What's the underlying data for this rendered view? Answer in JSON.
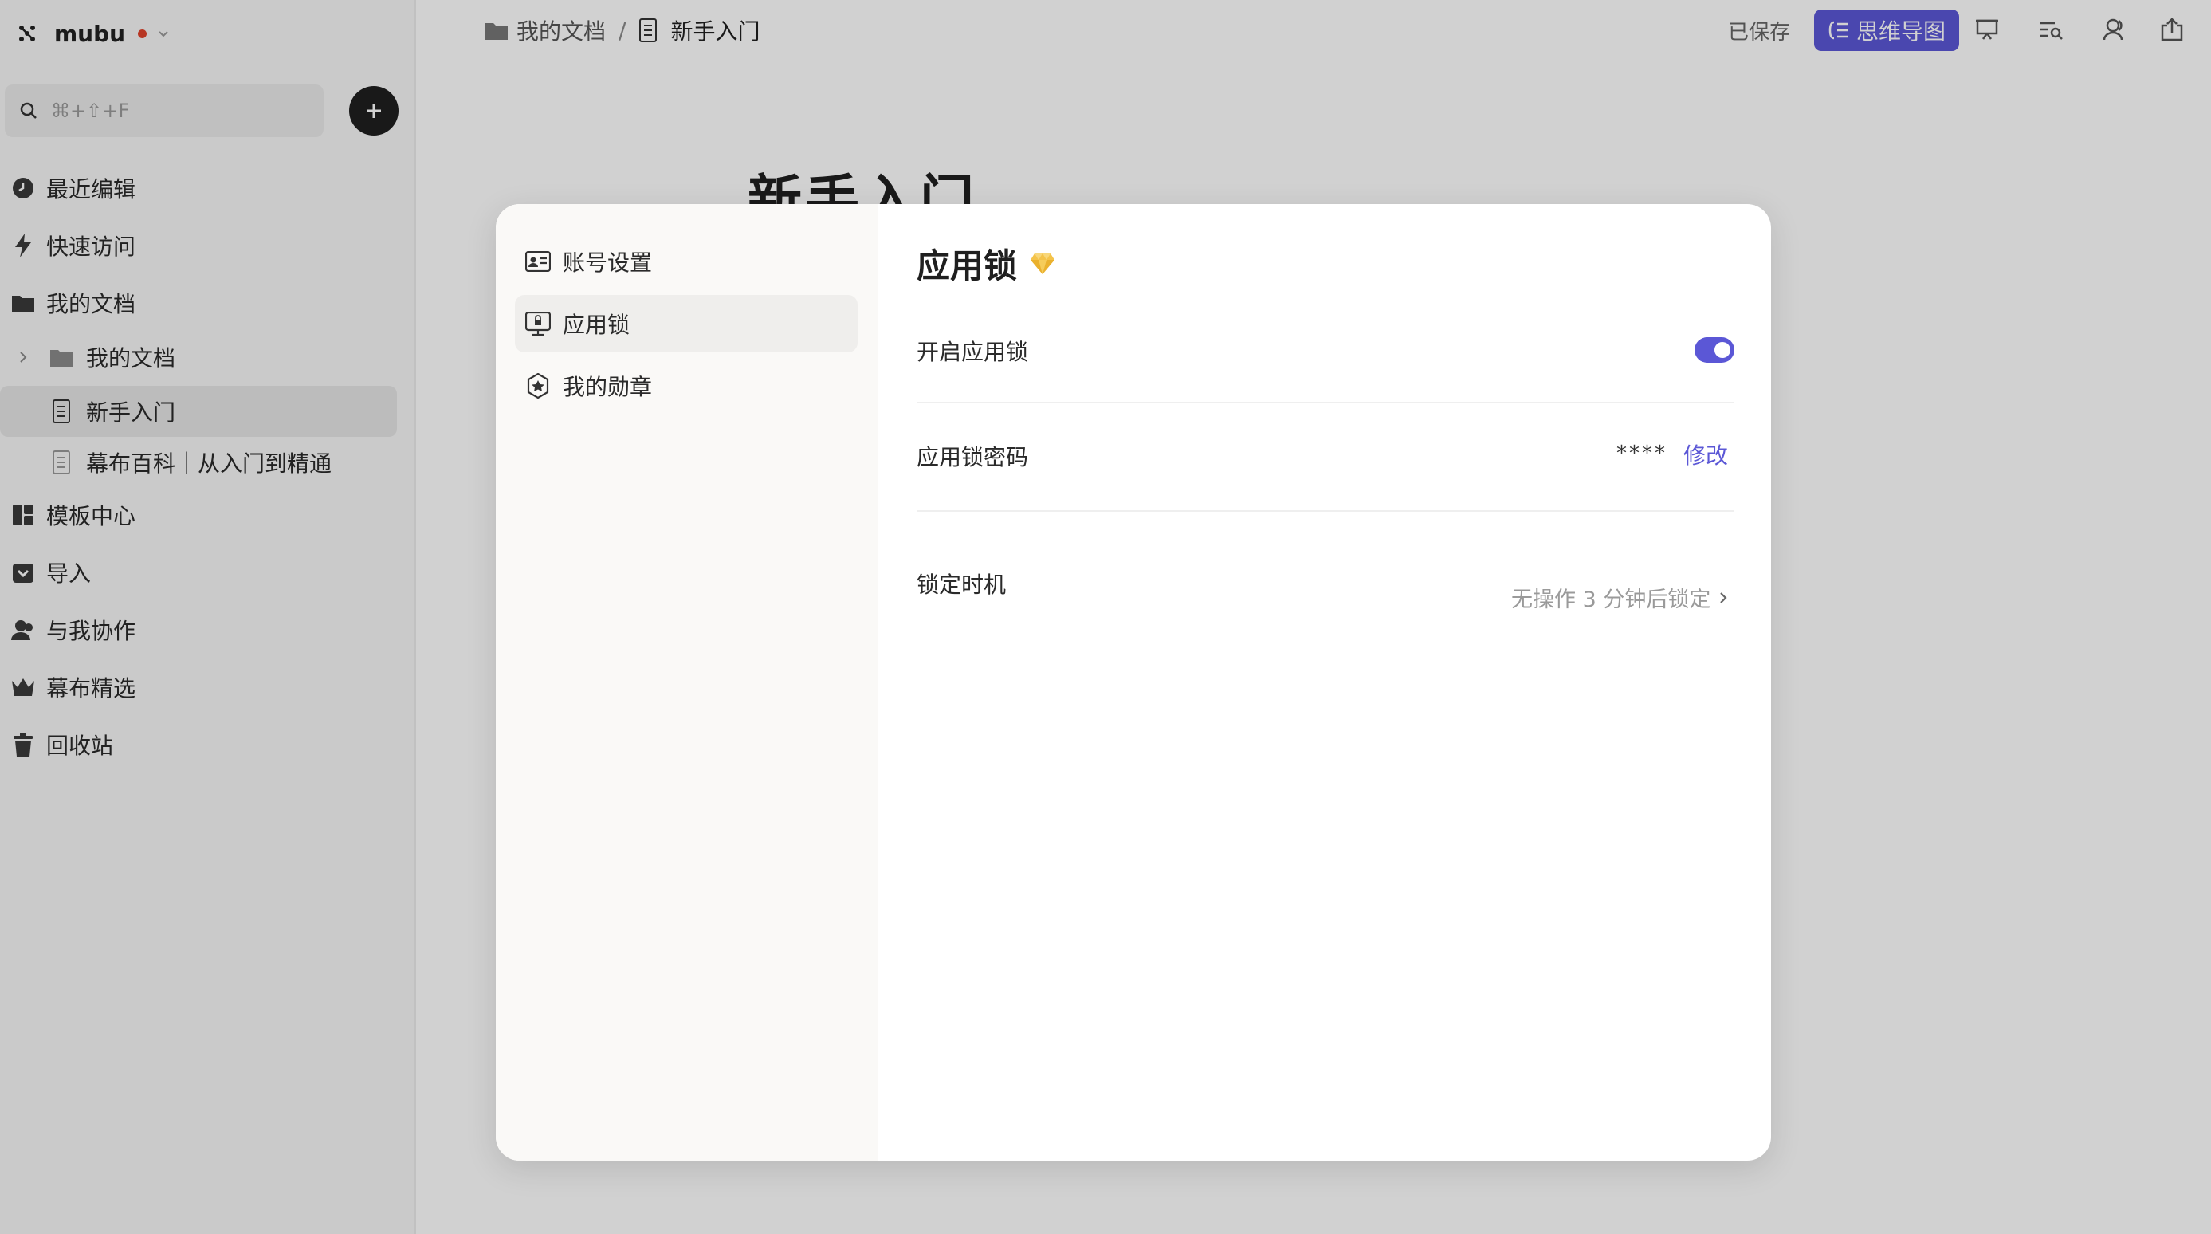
{
  "app": {
    "name": "mubu"
  },
  "search": {
    "placeholder": "⌘+⇧+F"
  },
  "sidebar": {
    "items": [
      {
        "label": "最近编辑",
        "icon": "clock-icon"
      },
      {
        "label": "快速访问",
        "icon": "lightning-icon"
      },
      {
        "label": "我的文档",
        "icon": "folder-icon"
      },
      {
        "label": "我的文档",
        "icon": "folder-icon"
      },
      {
        "label": "新手入门",
        "icon": "document-icon"
      },
      {
        "label": "幕布百科｜从入门到精通",
        "icon": "document-icon"
      },
      {
        "label": "模板中心",
        "icon": "template-icon"
      },
      {
        "label": "导入",
        "icon": "import-icon"
      },
      {
        "label": "与我协作",
        "icon": "collaborate-icon"
      },
      {
        "label": "幕布精选",
        "icon": "crown-icon"
      },
      {
        "label": "回收站",
        "icon": "trash-icon"
      }
    ]
  },
  "breadcrumb": {
    "parent": "我的文档",
    "separator": "/",
    "current": "新手入门"
  },
  "topbar": {
    "saved": "已保存",
    "mindmap": "思维导图"
  },
  "document": {
    "title": "新手入门"
  },
  "modal": {
    "menu": [
      {
        "label": "账号设置",
        "icon": "id-card-icon"
      },
      {
        "label": "应用锁",
        "icon": "lock-screen-icon"
      },
      {
        "label": "我的勋章",
        "icon": "badge-icon"
      }
    ],
    "title": "应用锁",
    "enable_lock": {
      "label": "开启应用锁",
      "enabled": true
    },
    "password": {
      "label": "应用锁密码",
      "mask": "****",
      "edit": "修改"
    },
    "lock_timing": {
      "label": "锁定时机",
      "value": "无操作 3 分钟后锁定"
    }
  },
  "colors": {
    "accent": "#5b57d6",
    "dot": "#e0442d",
    "overlay": "rgba(0,0,0,0.18)"
  }
}
